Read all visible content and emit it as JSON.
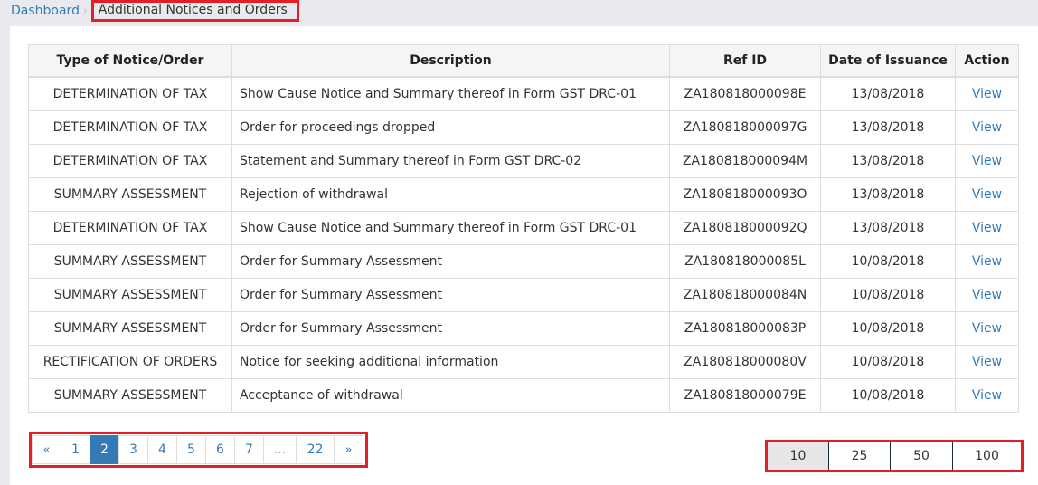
{
  "breadcrumb": {
    "home": "Dashboard",
    "separator": "›",
    "current": "Additional Notices and Orders"
  },
  "table": {
    "headers": [
      "Type of Notice/Order",
      "Description",
      "Ref ID",
      "Date of Issuance",
      "Action"
    ],
    "rows": [
      {
        "type": "DETERMINATION OF TAX",
        "description": "Show Cause Notice and Summary thereof in Form GST DRC-01",
        "ref_id": "ZA180818000098E",
        "date": "13/08/2018",
        "action": "View"
      },
      {
        "type": "DETERMINATION OF TAX",
        "description": "Order for proceedings dropped",
        "ref_id": "ZA180818000097G",
        "date": "13/08/2018",
        "action": "View"
      },
      {
        "type": "DETERMINATION OF TAX",
        "description": "Statement and Summary thereof in Form GST DRC-02",
        "ref_id": "ZA180818000094M",
        "date": "13/08/2018",
        "action": "View"
      },
      {
        "type": "SUMMARY ASSESSMENT",
        "description": "Rejection of withdrawal",
        "ref_id": "ZA180818000093O",
        "date": "13/08/2018",
        "action": "View"
      },
      {
        "type": "DETERMINATION OF TAX",
        "description": "Show Cause Notice and Summary thereof in Form GST DRC-01",
        "ref_id": "ZA180818000092Q",
        "date": "13/08/2018",
        "action": "View"
      },
      {
        "type": "SUMMARY ASSESSMENT",
        "description": "Order for Summary Assessment",
        "ref_id": "ZA180818000085L",
        "date": "10/08/2018",
        "action": "View"
      },
      {
        "type": "SUMMARY ASSESSMENT",
        "description": "Order for Summary Assessment",
        "ref_id": "ZA180818000084N",
        "date": "10/08/2018",
        "action": "View"
      },
      {
        "type": "SUMMARY ASSESSMENT",
        "description": "Order for Summary Assessment",
        "ref_id": "ZA180818000083P",
        "date": "10/08/2018",
        "action": "View"
      },
      {
        "type": "RECTIFICATION OF ORDERS",
        "description": "Notice for seeking additional information",
        "ref_id": "ZA180818000080V",
        "date": "10/08/2018",
        "action": "View"
      },
      {
        "type": "SUMMARY ASSESSMENT",
        "description": "Acceptance of withdrawal",
        "ref_id": "ZA180818000079E",
        "date": "10/08/2018",
        "action": "View"
      }
    ]
  },
  "pagination": {
    "prev": "«",
    "next": "»",
    "pages": [
      "1",
      "2",
      "3",
      "4",
      "5",
      "6",
      "7",
      "...",
      "22"
    ],
    "current": "2"
  },
  "page_size": {
    "options": [
      "10",
      "25",
      "50",
      "100"
    ],
    "selected": "10"
  },
  "colors": {
    "link": "#337ab7",
    "highlight_border": "#e31e24",
    "background": "#e8eaed"
  }
}
